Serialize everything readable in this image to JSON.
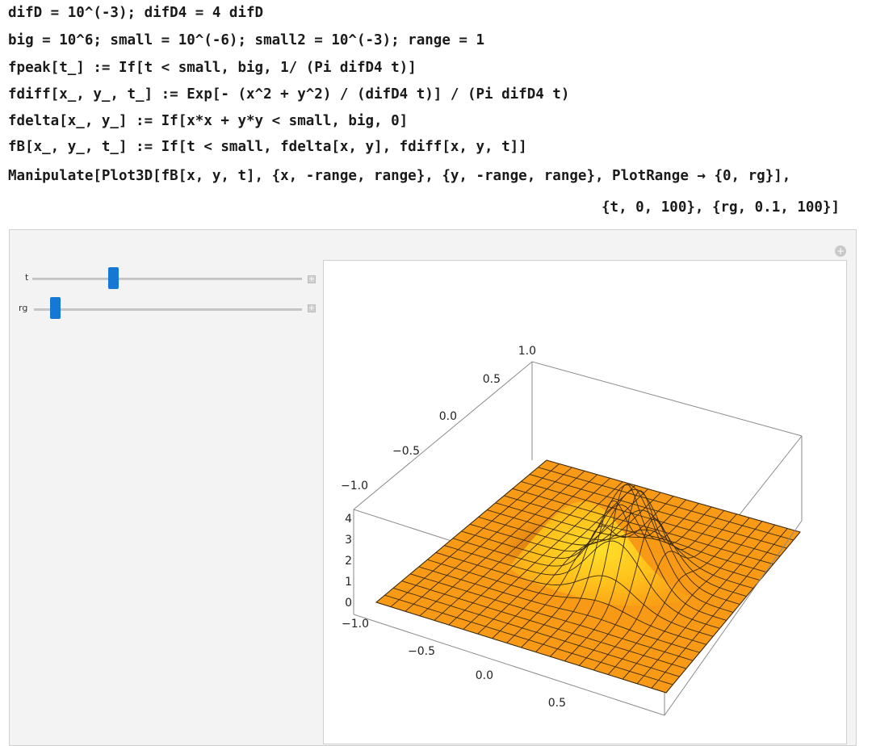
{
  "code": {
    "line1": "difD = 10^(-3); difD4 = 4 difD",
    "line2": "big = 10^6; small = 10^(-6); small2 = 10^(-3); range = 1",
    "line3": "fpeak[t_] := If[t < small, big, 1/ (Pi difD4 t)]",
    "line4": "fdiff[x_, y_, t_] := Exp[- (x^2 + y^2) / (difD4 t)] / (Pi difD4 t)",
    "line5": "fdelta[x_, y_] := If[x*x + y*y < small, big, 0]",
    "line6": "fB[x_, y_, t_] := If[t < small, fdelta[x, y], fdiff[x, y, t]]",
    "line7": "Manipulate[Plot3D[fB[x, y, t], {x, -range, range}, {y, -range, range}, PlotRange → {0, rg}],",
    "line8": "{t, 0, 100}, {rg, 0.1, 100}]"
  },
  "controls": {
    "t_label": "t",
    "rg_label": "rg",
    "plus_symbol": "+",
    "corner_symbol": "+",
    "t_value_fraction": 0.28,
    "rg_value_fraction": 0.06
  },
  "plot": {
    "y_ticks": [
      "1.0",
      "0.5",
      "0.0",
      "−0.5",
      "−1.0"
    ],
    "z_ticks": [
      "4",
      "3",
      "2",
      "1",
      "0"
    ],
    "x_ticks": [
      "−1.0",
      "−0.5",
      "0.0",
      "0.5"
    ],
    "surface_color": "#f99a16",
    "peak_color": "#ffe02a",
    "mesh_color": "#3a2a10"
  }
}
